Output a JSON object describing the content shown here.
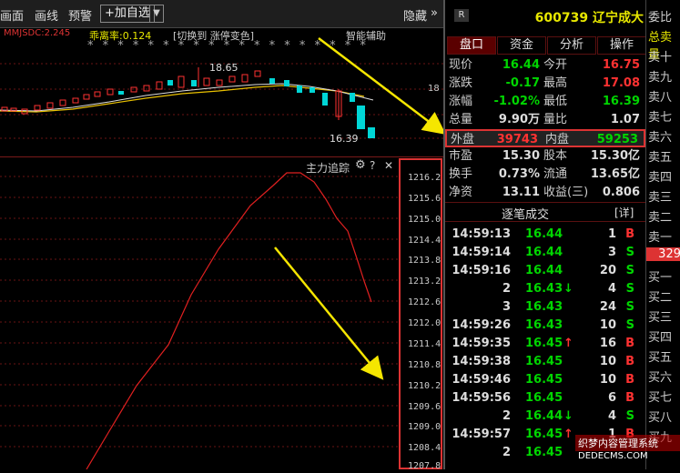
{
  "toolbar": {
    "items": [
      "画面",
      "画线",
      "预警"
    ],
    "add_watch": "+加自选",
    "dropdown": "▼",
    "hide": "隐藏",
    "hide_arrow": "»"
  },
  "kline": {
    "indicator_name": "MMJSDC:2.245",
    "deviation_label": "乖离率:0.124",
    "switch_label": "[切换到 涨停变色]",
    "assist_label": "智能辅助",
    "high_label": "18.65",
    "low_label": "16.39",
    "axis_label": "18",
    "stars": "* * * * * * * * * * * * * * * * * * *"
  },
  "tracker": {
    "title": "主力追踪",
    "gear": "⚙",
    "help": "?",
    "close": "✕",
    "y_labels": [
      "1216.2",
      "1215.6",
      "1215.0",
      "1214.4",
      "1213.8",
      "1213.2",
      "1212.6",
      "1212.0",
      "1211.4",
      "1210.8",
      "1210.2",
      "1209.6",
      "1209.0",
      "1208.4",
      "1207.8"
    ]
  },
  "stock": {
    "badge": "R",
    "code_name": "600739 辽宁成大"
  },
  "tabs": [
    "盘口",
    "资金",
    "分析",
    "操作"
  ],
  "quote": {
    "rows": [
      {
        "l1": "现价",
        "v1": "16.44",
        "c1": "green",
        "l2": "今开",
        "v2": "16.75",
        "c2": "red"
      },
      {
        "l1": "涨跌",
        "v1": "-0.17",
        "c1": "green",
        "l2": "最高",
        "v2": "17.08",
        "c2": "red"
      },
      {
        "l1": "涨幅",
        "v1": "-1.02%",
        "c1": "green",
        "l2": "最低",
        "v2": "16.39",
        "c2": "green"
      },
      {
        "l1": "总量",
        "v1": "9.90万",
        "c1": "white",
        "l2": "量比",
        "v2": "1.07",
        "c2": "white"
      },
      {
        "l1": "外盘",
        "v1": "39743",
        "c1": "red",
        "l2": "内盘",
        "v2": "59253",
        "c2": "green"
      },
      {
        "l1": "市盈",
        "v1": "15.30",
        "c1": "white",
        "l2": "股本",
        "v2": "15.30亿",
        "c2": "white"
      },
      {
        "l1": "换手",
        "v1": "0.73%",
        "c1": "white",
        "l2": "流通",
        "v2": "13.65亿",
        "c2": "white"
      },
      {
        "l1": "净资",
        "v1": "13.11",
        "c1": "white",
        "l2": "收益(三)",
        "v2": "0.806",
        "c2": "white"
      }
    ]
  },
  "detail": {
    "title": "逐笔成交",
    "detail_btn": "[详]",
    "trades": [
      {
        "t": "14:59:13",
        "p": "16.44",
        "pc": "green",
        "a": "",
        "v": "1",
        "s": "B",
        "sc": "red"
      },
      {
        "t": "14:59:14",
        "p": "16.44",
        "pc": "green",
        "a": "",
        "v": "3",
        "s": "S",
        "sc": "green"
      },
      {
        "t": "14:59:16",
        "p": "16.44",
        "pc": "green",
        "a": "",
        "v": "20",
        "s": "S",
        "sc": "green"
      },
      {
        "t": "2",
        "p": "16.43",
        "pc": "green",
        "a": "↓",
        "ac": "green",
        "v": "4",
        "s": "S",
        "sc": "green"
      },
      {
        "t": "3",
        "p": "16.43",
        "pc": "green",
        "a": "",
        "v": "24",
        "s": "S",
        "sc": "green"
      },
      {
        "t": "14:59:26",
        "p": "16.43",
        "pc": "green",
        "a": "",
        "v": "10",
        "s": "S",
        "sc": "green"
      },
      {
        "t": "14:59:35",
        "p": "16.45",
        "pc": "green",
        "a": "↑",
        "ac": "red",
        "v": "16",
        "s": "B",
        "sc": "red"
      },
      {
        "t": "14:59:38",
        "p": "16.45",
        "pc": "green",
        "a": "",
        "v": "10",
        "s": "B",
        "sc": "red"
      },
      {
        "t": "14:59:46",
        "p": "16.45",
        "pc": "green",
        "a": "",
        "v": "10",
        "s": "B",
        "sc": "red"
      },
      {
        "t": "14:59:56",
        "p": "16.45",
        "pc": "green",
        "a": "",
        "v": "6",
        "s": "B",
        "sc": "red"
      },
      {
        "t": "2",
        "p": "16.44",
        "pc": "green",
        "a": "↓",
        "ac": "green",
        "v": "4",
        "s": "S",
        "sc": "green"
      },
      {
        "t": "14:59:57",
        "p": "16.45",
        "pc": "green",
        "a": "↑",
        "ac": "red",
        "v": "1",
        "s": "B",
        "sc": "red"
      },
      {
        "t": "2",
        "p": "16.45",
        "pc": "green",
        "a": "",
        "v": "",
        "s": "",
        "sc": "red"
      }
    ]
  },
  "orderbook": {
    "labels": [
      "委比",
      "总卖量",
      "卖十",
      "卖九",
      "卖八",
      "卖七",
      "卖六",
      "卖五",
      "卖四",
      "卖三",
      "卖二",
      "卖一",
      "329",
      "买一",
      "买二",
      "买三",
      "买四",
      "买五",
      "买六",
      "买七",
      "买八",
      "买九"
    ]
  },
  "watermark": {
    "line1": "织梦内容管理系统",
    "line2": "DEDECMS.COM"
  }
}
